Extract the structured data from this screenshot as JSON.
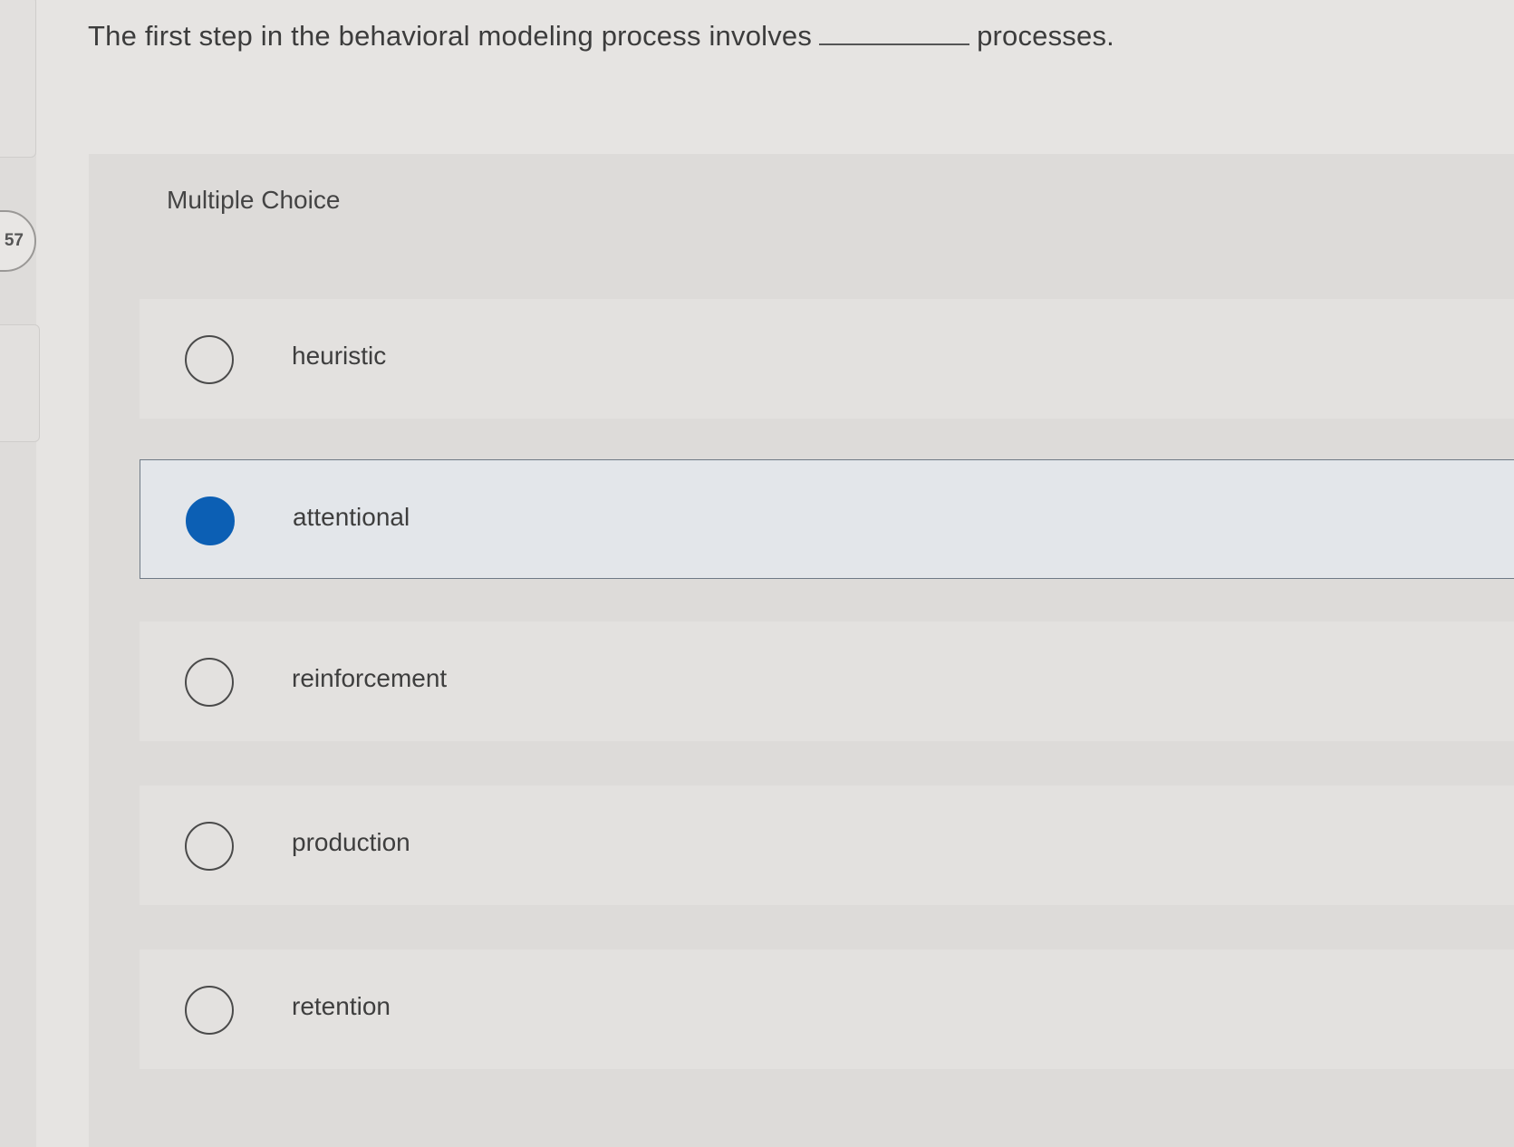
{
  "question": {
    "number": "57",
    "text_before": "The first step in the behavioral modeling process involves",
    "text_after": "processes."
  },
  "panel": {
    "label": "Multiple Choice"
  },
  "options": [
    {
      "label": "heuristic",
      "selected": false
    },
    {
      "label": "attentional",
      "selected": true
    },
    {
      "label": "reinforcement",
      "selected": false
    },
    {
      "label": "production",
      "selected": false
    },
    {
      "label": "retention",
      "selected": false
    }
  ],
  "colors": {
    "selected_radio": "#0c5fb4",
    "background": "#e6e4e2"
  }
}
